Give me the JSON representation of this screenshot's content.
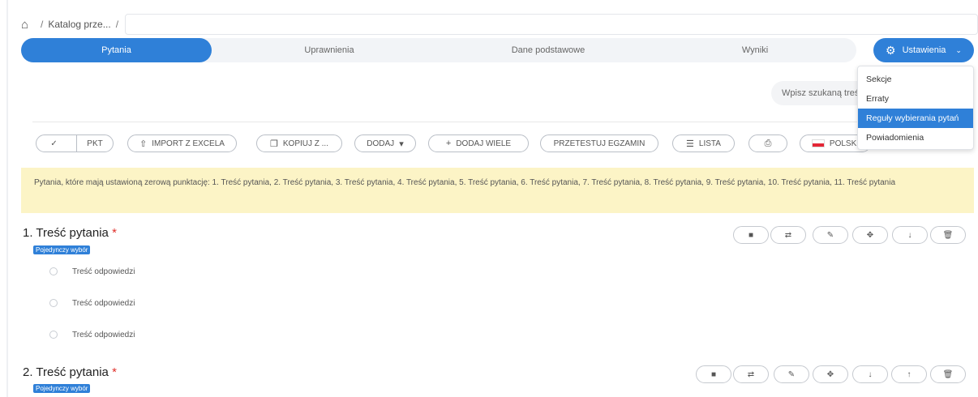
{
  "breadcrumb": {
    "home_icon": "home-icon",
    "item": "Katalog prze...",
    "separator": "/"
  },
  "tabs": [
    {
      "label": "Pytania",
      "active": true
    },
    {
      "label": "Uprawnienia",
      "active": false
    },
    {
      "label": "Dane podstawowe",
      "active": false
    },
    {
      "label": "Wyniki",
      "active": false
    }
  ],
  "settings": {
    "label": "Ustawienia",
    "icon": "gear-icon",
    "menu": [
      {
        "label": "Sekcje"
      },
      {
        "label": "Erraty"
      },
      {
        "label": "Reguły wybierania pytań"
      },
      {
        "label": "Powiadomienia"
      }
    ]
  },
  "search": {
    "placeholder": "Wpisz szukaną treść"
  },
  "toolbar": {
    "check_icon": "check-icon",
    "pkt": "PKT",
    "import": "IMPORT Z EXCELA",
    "copy": "KOPIUJ Z ...",
    "add": "DODAJ",
    "add_many": "DODAJ WIELE",
    "test": "PRZETESTUJ EGZAMIN",
    "list": "LISTA",
    "language": "POLSKI"
  },
  "notice": "Pytania, które mają ustawioną zerową punktację: 1. Treść pytania, 2. Treść pytania, 3. Treść pytania, 4. Treść pytania, 5. Treść pytania, 6. Treść pytania, 7. Treść pytania, 8. Treść pytania, 9. Treść pytania, 10. Treść pytania, 11. Treść pytania",
  "questions": [
    {
      "title": "1. Treść pytania",
      "required": "*",
      "type": "Pojedynczy wybór",
      "answers": [
        "Treść odpowiedzi",
        "Treść odpowiedzi",
        "Treść odpowiedzi"
      ]
    },
    {
      "title": "2. Treść pytania",
      "required": "*",
      "type": "Pojedynczy wybór",
      "answers": []
    }
  ],
  "colors": {
    "accent": "#2f80d8",
    "notice_bg": "#fcf4c6",
    "required": "#e0302b"
  }
}
